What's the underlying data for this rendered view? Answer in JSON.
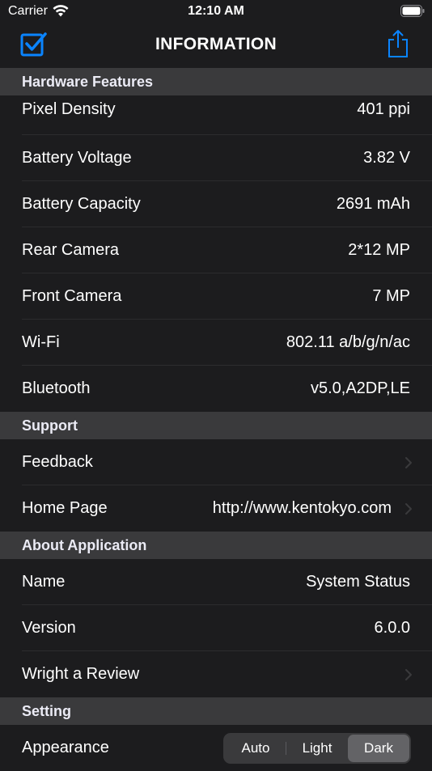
{
  "status_bar": {
    "carrier": "Carrier",
    "time": "12:10 AM"
  },
  "nav": {
    "title": "INFORMATION"
  },
  "colors": {
    "accent": "#0a84ff",
    "background": "#1c1c1e",
    "section_bg": "#3a3a3c"
  },
  "sections": {
    "hardware": {
      "header": "Hardware Features",
      "rows": [
        {
          "label": "Pixel Density",
          "value": "401 ppi"
        },
        {
          "label": "Battery Voltage",
          "value": "3.82 V"
        },
        {
          "label": "Battery Capacity",
          "value": "2691 mAh"
        },
        {
          "label": "Rear Camera",
          "value": "2*12 MP"
        },
        {
          "label": "Front Camera",
          "value": "7 MP"
        },
        {
          "label": "Wi-Fi",
          "value": "802.11 a/b/g/n/ac"
        },
        {
          "label": "Bluetooth",
          "value": "v5.0,A2DP,LE"
        }
      ]
    },
    "support": {
      "header": "Support",
      "rows": [
        {
          "label": "Feedback",
          "value": ""
        },
        {
          "label": "Home Page",
          "value": "http://www.kentokyo.com"
        }
      ]
    },
    "about": {
      "header": "About Application",
      "rows": [
        {
          "label": "Name",
          "value": "System Status"
        },
        {
          "label": "Version",
          "value": "6.0.0"
        },
        {
          "label": "Wright a Review",
          "value": ""
        }
      ]
    },
    "setting": {
      "header": "Setting",
      "appearance_label": "Appearance",
      "options": [
        "Auto",
        "Light",
        "Dark"
      ],
      "selected": "Dark"
    }
  }
}
